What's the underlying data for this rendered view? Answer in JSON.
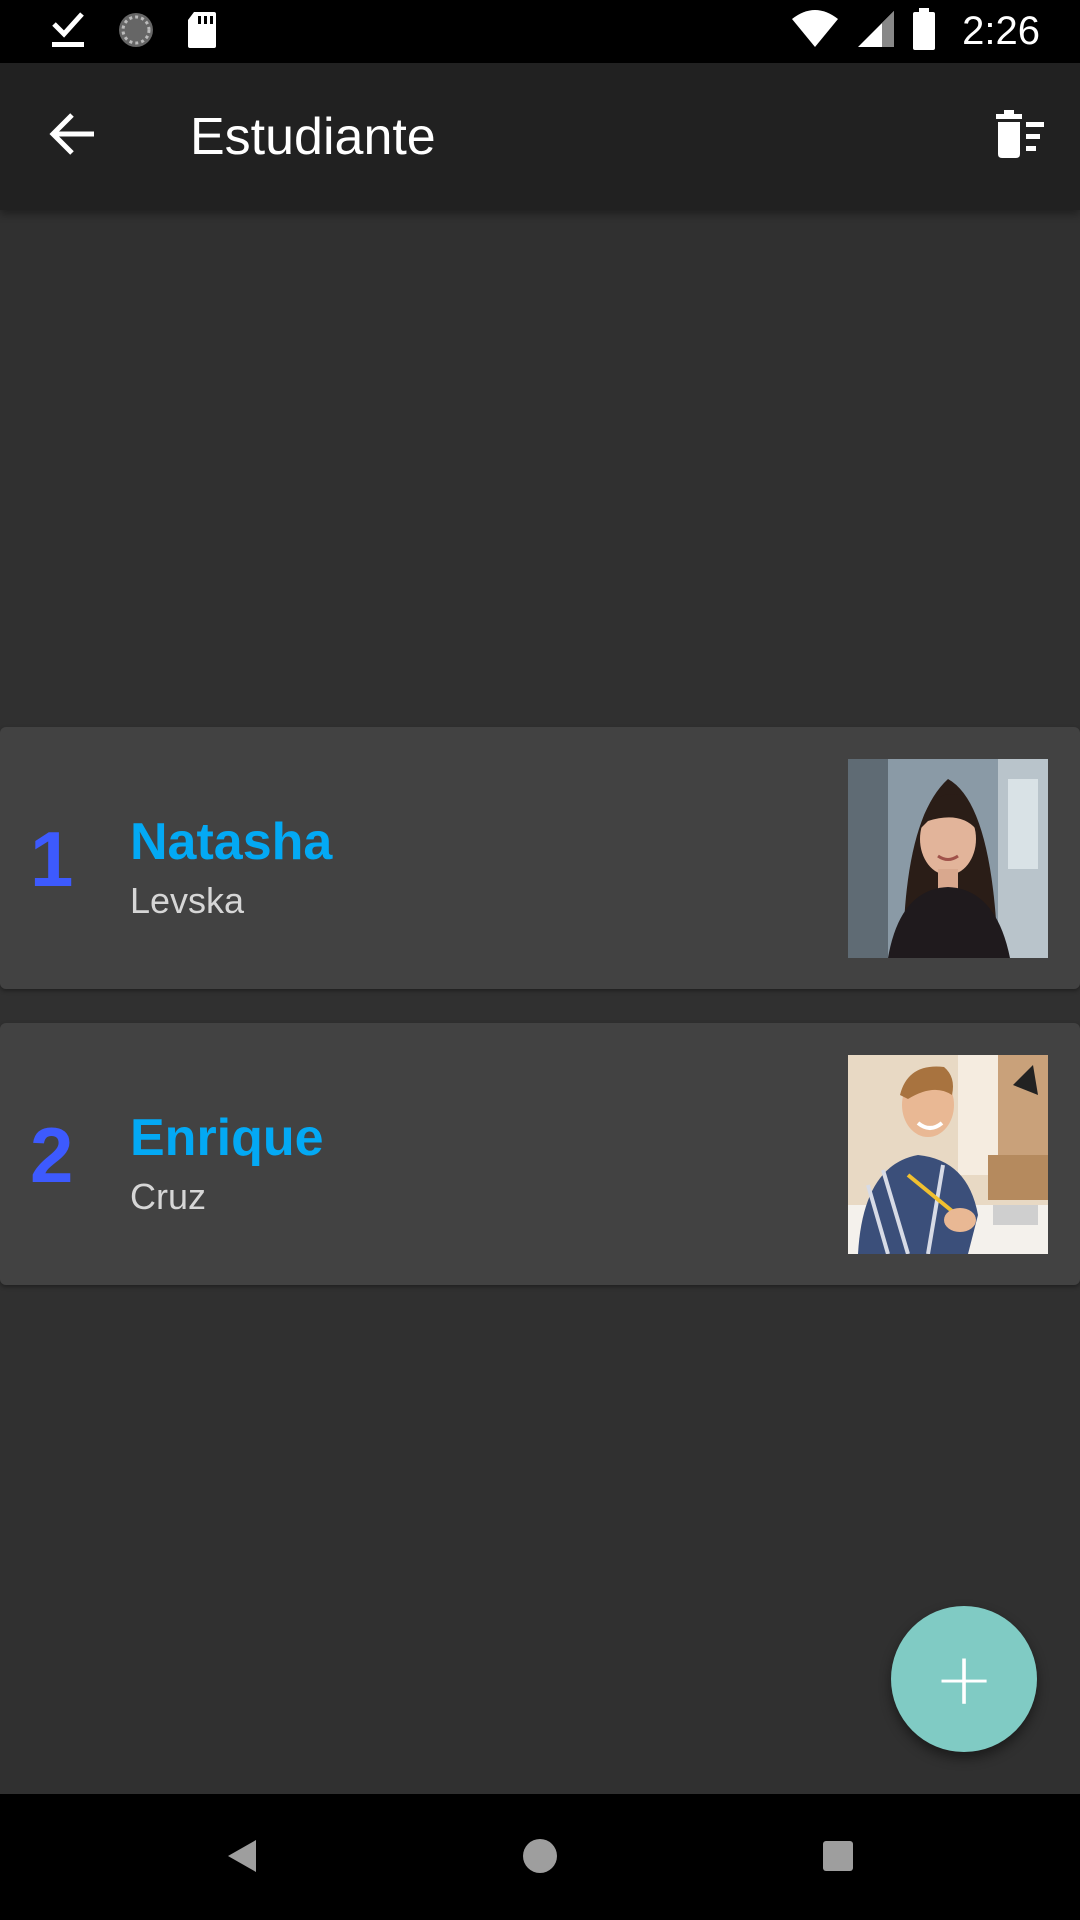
{
  "status_bar": {
    "time": "2:26",
    "left_icons": [
      "download-done-icon",
      "sync-icon",
      "sd-card-icon"
    ],
    "right_icons": [
      "wifi-icon",
      "cell-signal-icon",
      "battery-icon"
    ]
  },
  "app_bar": {
    "title": "Estudiante",
    "back_icon": "arrow-back-icon",
    "action_icon": "delete-sweep-icon"
  },
  "students": [
    {
      "number": "1",
      "first_name": "Natasha",
      "last_name": "Levska",
      "photo": "student-photo-woman"
    },
    {
      "number": "2",
      "first_name": "Enrique",
      "last_name": "Cruz",
      "photo": "student-photo-man-writing"
    }
  ],
  "fab": {
    "icon": "add-icon",
    "label": "+"
  },
  "nav_bar": {
    "buttons": [
      "back-triangle-icon",
      "home-circle-icon",
      "recents-square-icon"
    ]
  },
  "colors": {
    "background": "#303030",
    "app_bar": "#212121",
    "card": "#424242",
    "number": "#3d5afe",
    "first_name": "#03a9f4",
    "last_name": "#d6d6d6",
    "fab": "#80cbc4"
  }
}
